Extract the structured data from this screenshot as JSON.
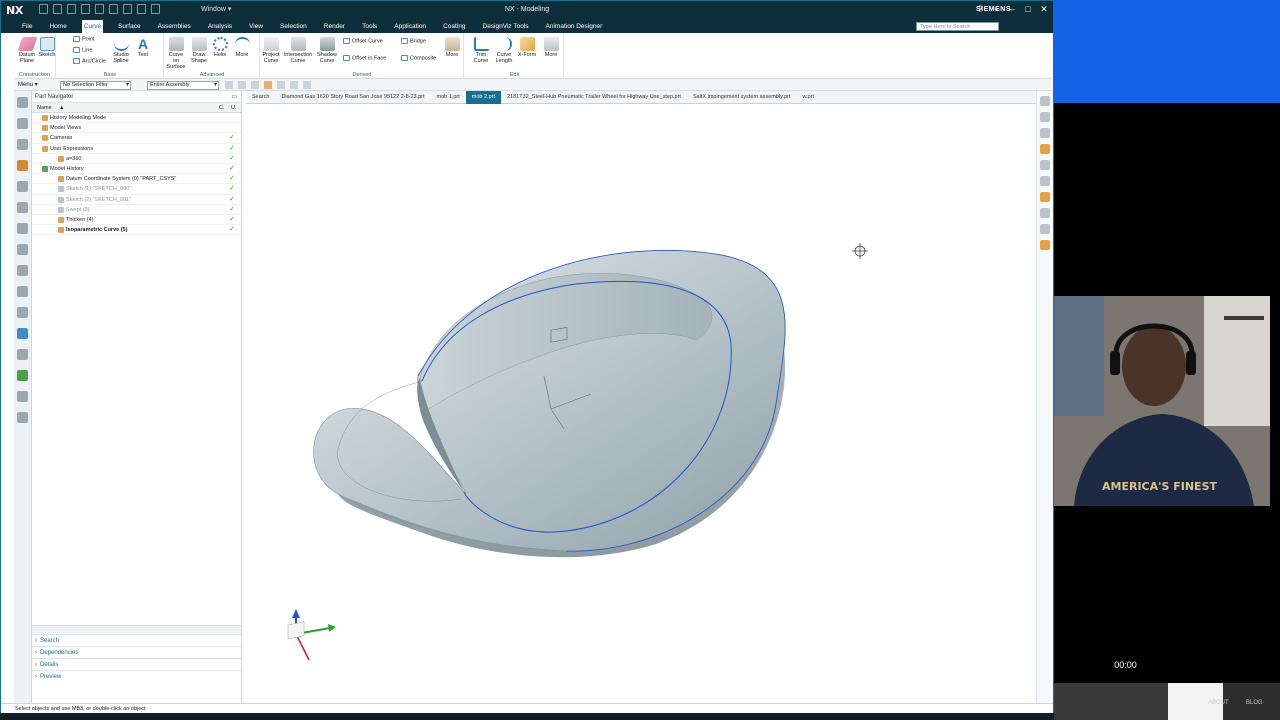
{
  "app": {
    "logo": "NX",
    "title": "NX - Modeling",
    "brand": "SIEMENS",
    "window_menu": "Window ▾"
  },
  "menu_tabs": [
    "File",
    "Home",
    "Curve",
    "Surface",
    "Assemblies",
    "Analysis",
    "View",
    "Selection",
    "Render",
    "Tools",
    "Application",
    "Coating",
    "DesignViz Tools",
    "Animation Designer"
  ],
  "search_placeholder": "Type Here to Search",
  "ribbon": {
    "construction": {
      "datum_plane": "Datum Plane",
      "sketch": "Sketch",
      "label": "Construction"
    },
    "base": {
      "point": "Point",
      "line": "Line",
      "arc": "Arc/Circle",
      "studio_spline": "Studio Spline",
      "text": "Text",
      "label": "Base"
    },
    "advanced": {
      "curve_on_surface": "Curve on Surface",
      "draw_shape": "Draw Shape",
      "helix": "Helix",
      "more": "More",
      "label": "Advanced"
    },
    "derived": {
      "project": "Project Curve",
      "intersection": "Intersection Curve",
      "shadow": "Shadow Curve",
      "offset_curve": "Offset Curve",
      "offset_in_face": "Offset in Face",
      "bridge": "Bridge",
      "composite": "Composite",
      "more": "More",
      "label": "Derived"
    },
    "edit": {
      "trim": "Trim Curve",
      "curve_length": "Curve Length",
      "xform": "X-Form",
      "more": "More",
      "label": "Edit"
    }
  },
  "selbar": {
    "menu": "Menu ▾",
    "filter": "No Selection Filter",
    "scope": "Entire Assembly"
  },
  "navigator": {
    "title": "Part Navigator",
    "columns": {
      "name": "Name",
      "c": "C.",
      "u": "U."
    },
    "rows": [
      {
        "text": "History Modeling Mode",
        "indent": 0,
        "check": false,
        "style": ""
      },
      {
        "text": "Model Views",
        "indent": 0,
        "check": false,
        "style": ""
      },
      {
        "text": "Cameras",
        "indent": 0,
        "check": true,
        "style": ""
      },
      {
        "text": "User Expressions",
        "indent": 0,
        "check": true,
        "style": ""
      },
      {
        "text": "a=360",
        "indent": 2,
        "check": true,
        "style": ""
      },
      {
        "text": "Model History",
        "indent": 0,
        "check": true,
        "style": ""
      },
      {
        "text": "Datum Coordinate System (0) \"PART_CSYS\"",
        "indent": 2,
        "check": true,
        "style": ""
      },
      {
        "text": "Sketch (1) \"SKETCH_000\"",
        "indent": 2,
        "check": true,
        "style": "grey"
      },
      {
        "text": "Sketch (2) \"SKETCH_001\"",
        "indent": 2,
        "check": true,
        "style": "grey"
      },
      {
        "text": "Swept (3)",
        "indent": 2,
        "check": true,
        "style": "grey"
      },
      {
        "text": "Thicken (4)",
        "indent": 2,
        "check": true,
        "style": ""
      },
      {
        "text": "Isoparametric Curve (5)",
        "indent": 2,
        "check": true,
        "style": "bold"
      }
    ],
    "sections": [
      "Search",
      "Dependencies",
      "Details",
      "Preview"
    ]
  },
  "doc_tabs": [
    {
      "label": "Search",
      "active": false
    },
    {
      "label": "Diamond Gas 1620 Story Road San Jose 95122 2-8-23.prt",
      "active": false
    },
    {
      "label": "mob 1.prt",
      "active": false
    },
    {
      "label": "mob 2.prt",
      "active": true
    },
    {
      "label": "2181T32_Steel-Hub Pneumatic Trailer Wheel for Highway Use_step.prt",
      "active": false
    },
    {
      "label": "SaltX impingement system assembly.prt",
      "active": false
    },
    {
      "label": "w.prt",
      "active": false
    }
  ],
  "status_text": "Select objects and use MB3, or double-click an object",
  "video": {
    "timecode": "00:00",
    "links": [
      "ABOUT",
      "BLOG"
    ],
    "shirt_text": "AMERICA'S FINEST"
  },
  "colors": {
    "title_bg": "#0f2e3b",
    "accent": "#17708f",
    "model": "#b9c6cc",
    "curve": "#1f56c7"
  }
}
